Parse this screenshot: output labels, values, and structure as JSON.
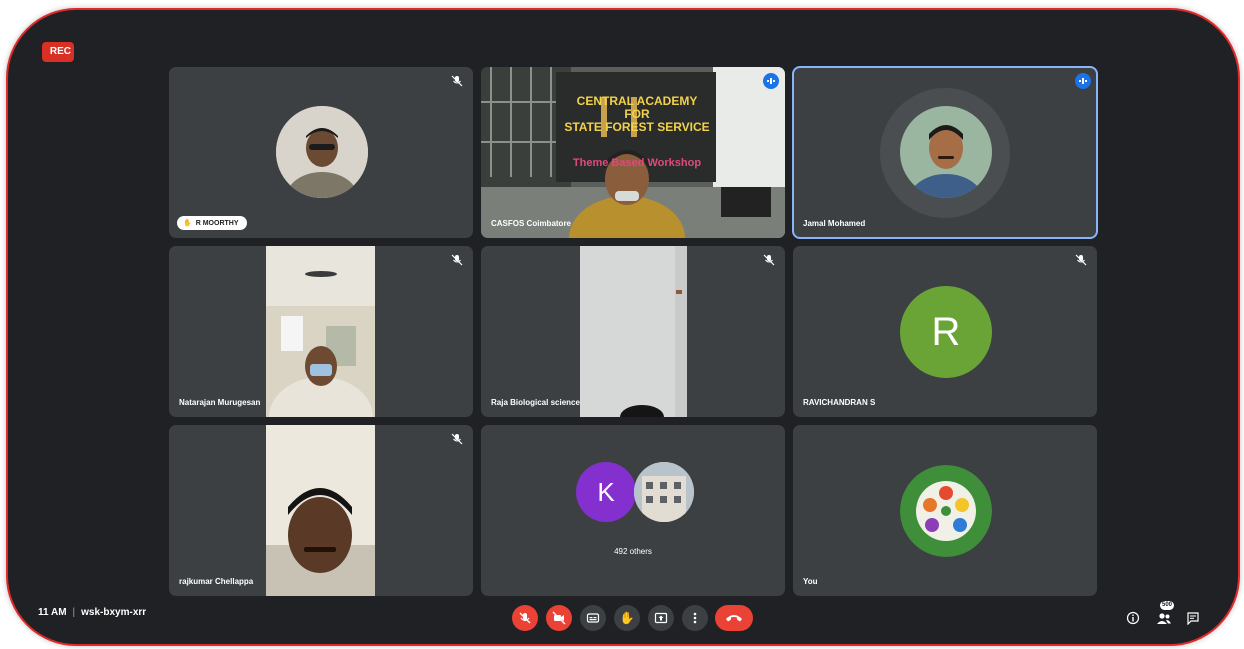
{
  "recording_label": "REC",
  "tiles": {
    "r_moorthy": {
      "name": "R MOORTHY"
    },
    "casfos": {
      "name": "CASFOS Coimbatore",
      "banner_line1": "CENTRAL ACADEMY FOR",
      "banner_line2": "STATE FOREST SERVICE",
      "banner_sub": "Theme Based Workshop"
    },
    "jamal": {
      "name": "Jamal Mohamed"
    },
    "natarajan": {
      "name": "Natarajan Murugesan"
    },
    "raja": {
      "name": "Raja Biological science"
    },
    "ravichandran": {
      "name": "RAVICHANDRAN S",
      "initial": "R"
    },
    "rajkumar": {
      "name": "rajkumar Chellappa"
    },
    "others": {
      "label": "492 others",
      "initial": "K"
    },
    "you": {
      "name": "You"
    }
  },
  "bottom_bar": {
    "time": "11 AM",
    "meeting_code": "wsk-bxym-xrr",
    "participants_count": "500"
  },
  "colors": {
    "background": "#202124",
    "tile": "#3c4043",
    "red": "#ea4335",
    "accent": "#1a73e8",
    "avatar_green": "#6aa437",
    "avatar_purple": "#8430ce"
  }
}
